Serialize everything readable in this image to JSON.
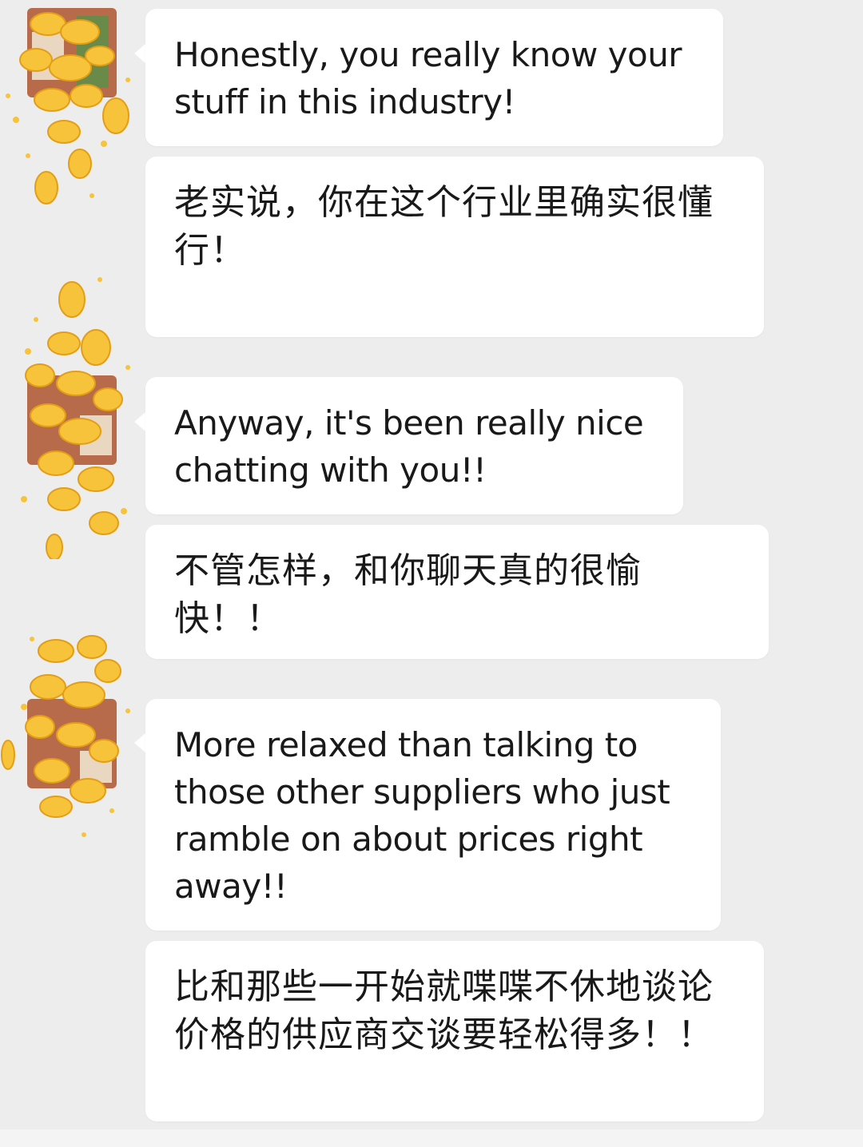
{
  "chat": {
    "background_color": "#ededed",
    "bubble_color": "#ffffff",
    "avatar_decoration": "gold-ingot-sticker",
    "messages": [
      {
        "text": "Honestly, you really know your stuff in this industry!"
      },
      {
        "text": "老实说，你在这个行业里确实很懂行！"
      },
      {
        "text": "Anyway, it's been really nice chatting with you!!"
      },
      {
        "text": "不管怎样，和你聊天真的很愉快！！"
      },
      {
        "text": "More relaxed than talking to those other suppliers who just ramble on about prices right away!!"
      },
      {
        "text": "比和那些一开始就喋喋不休地谈论价格的供应商交谈要轻松得多！！"
      }
    ]
  }
}
